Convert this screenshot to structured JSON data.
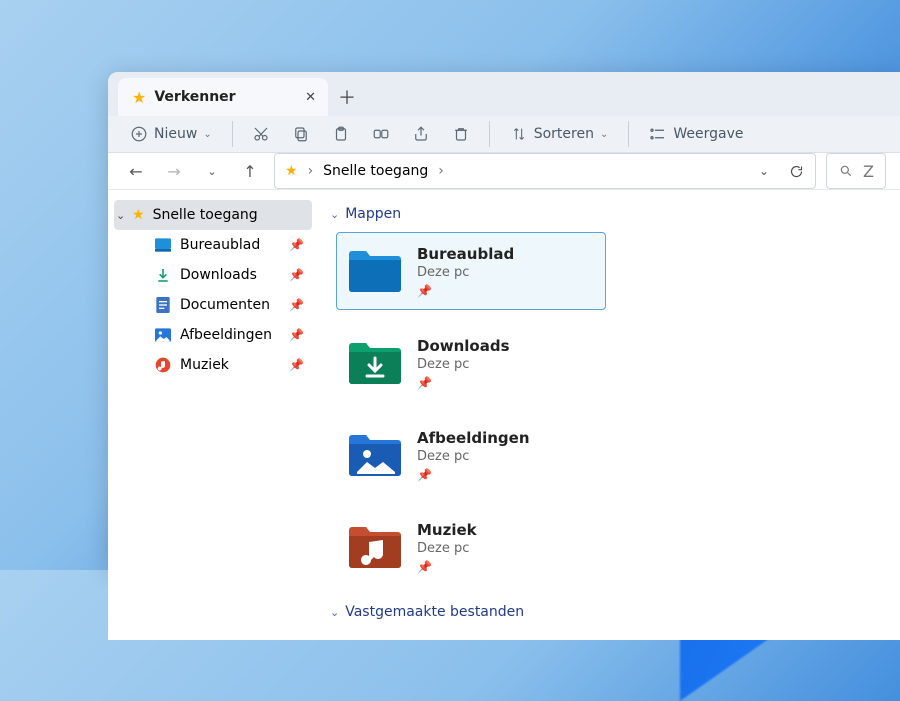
{
  "tab": {
    "icon": "star-icon",
    "title": "Verkenner"
  },
  "toolbar": {
    "new_label": "Nieuw",
    "sort_label": "Sorteren",
    "view_label": "Weergave"
  },
  "address": {
    "root": "Snelle toegang",
    "refresh": "refresh-icon",
    "search_placeholder": "Z"
  },
  "sidebar": {
    "root": {
      "label": "Snelle toegang",
      "icon": "star-icon"
    },
    "items": [
      {
        "label": "Bureaublad",
        "icon": "desktop-icon",
        "pinned": true
      },
      {
        "label": "Downloads",
        "icon": "download-icon",
        "pinned": true
      },
      {
        "label": "Documenten",
        "icon": "document-icon",
        "pinned": true
      },
      {
        "label": "Afbeeldingen",
        "icon": "picture-icon",
        "pinned": true
      },
      {
        "label": "Muziek",
        "icon": "music-icon",
        "pinned": true
      }
    ]
  },
  "sections": {
    "folders_label": "Mappen",
    "pinned_label": "Vastgemaakte bestanden"
  },
  "folders": [
    {
      "title": "Bureaublad",
      "subtitle": "Deze pc",
      "pinned": true,
      "selected": true,
      "color": "#1f8fd9"
    },
    {
      "title": "Downloads",
      "subtitle": "Deze pc",
      "pinned": true,
      "selected": false,
      "color": "#0e9f6e"
    },
    {
      "title": "Afbeeldingen",
      "subtitle": "Deze pc",
      "pinned": true,
      "selected": false,
      "color": "#2676d9"
    },
    {
      "title": "Muziek",
      "subtitle": "Deze pc",
      "pinned": true,
      "selected": false,
      "color": "#c44e2f"
    }
  ]
}
